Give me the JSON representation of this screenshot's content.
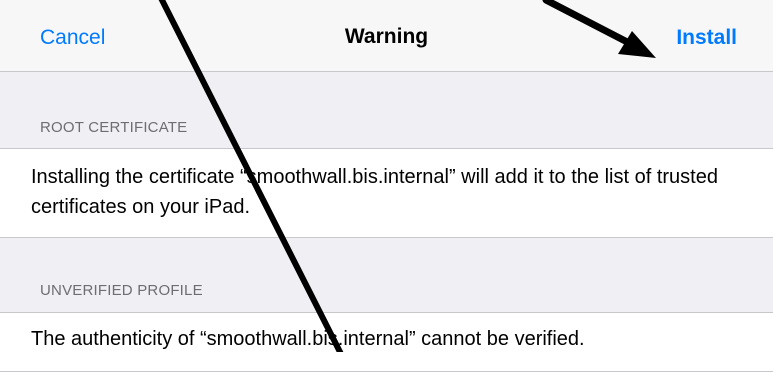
{
  "navbar": {
    "cancel_label": "Cancel",
    "title": "Warning",
    "install_label": "Install"
  },
  "sections": [
    {
      "header": "ROOT CERTIFICATE",
      "text": "Installing the certificate “smoothwall.bis.internal” will add it to the list of trusted certificates on your iPad."
    },
    {
      "header": "UNVERIFIED PROFILE",
      "text": "The authenticity of “smoothwall.bis.internal” cannot be verified."
    }
  ],
  "colors": {
    "accent": "#007aff",
    "background": "#efeff4",
    "header_text": "#6d6d72",
    "annotation": "#000000"
  },
  "annotations": {
    "icon": "arrow-annotation-icon"
  }
}
